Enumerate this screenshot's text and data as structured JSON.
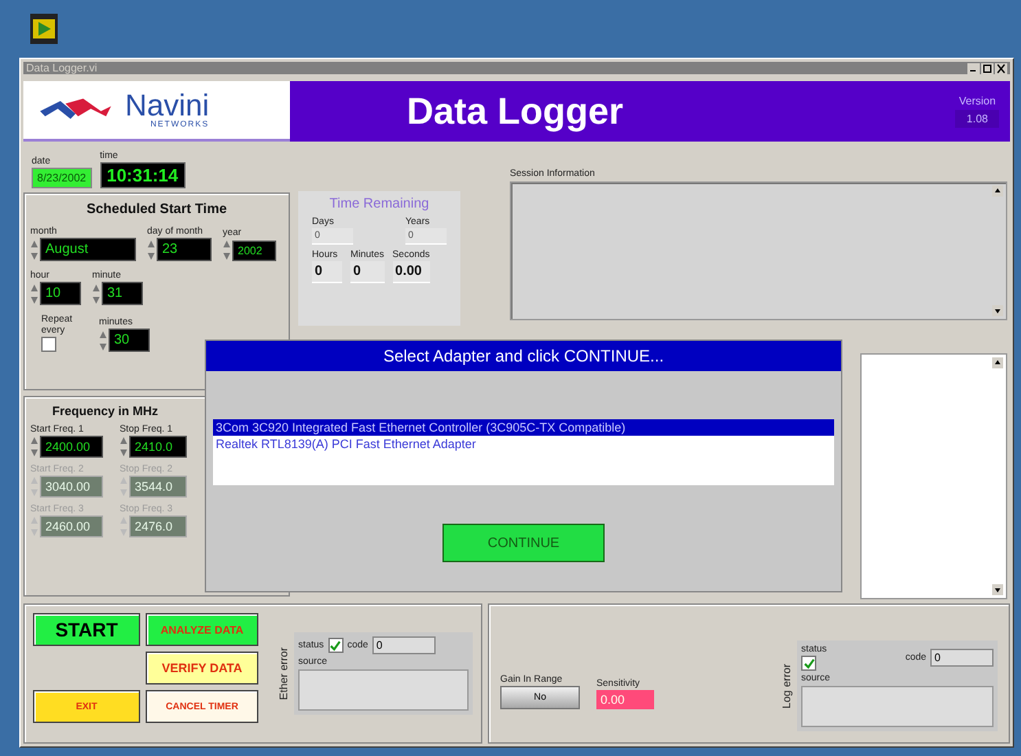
{
  "window": {
    "title": "Data Logger.vi"
  },
  "header": {
    "logo_text": "Navini",
    "logo_subtext": "NETWORKS",
    "title": "Data Logger",
    "version_label": "Version",
    "version": "1.08"
  },
  "date": {
    "label": "date",
    "value": "8/23/2002"
  },
  "time": {
    "label": "time",
    "value": "10:31:14"
  },
  "schedule": {
    "title": "Scheduled Start Time",
    "row1": [
      {
        "label": "month",
        "value": "August"
      },
      {
        "label": "day of month",
        "value": "23"
      },
      {
        "label": "year",
        "value": "2002"
      }
    ],
    "row2": [
      {
        "label": "hour",
        "value": "10"
      },
      {
        "label": "minute",
        "value": "31"
      }
    ],
    "repeat": {
      "label": "Repeat every",
      "checked": false
    },
    "interval": {
      "label": "minutes",
      "value": "30"
    }
  },
  "frequency": {
    "title": "Frequency in MHz",
    "rows": [
      [
        {
          "label": "Start Freq. 1",
          "value": "2400.00",
          "disabled": false
        },
        {
          "label": "Stop Freq. 1",
          "value": "2410.0",
          "disabled": false
        }
      ],
      [
        {
          "label": "Start Freq. 2",
          "value": "3040.00",
          "disabled": true
        },
        {
          "label": "Stop Freq. 2",
          "value": "3544.0",
          "disabled": true
        }
      ],
      [
        {
          "label": "Start Freq. 3",
          "value": "2460.00",
          "disabled": true
        },
        {
          "label": "Stop Freq. 3",
          "value": "2476.0",
          "disabled": true
        }
      ]
    ]
  },
  "time_remaining": {
    "title": "Time Remaining",
    "row1": [
      {
        "label": "Days",
        "value": "0"
      },
      {
        "label": "Years",
        "value": "0"
      }
    ],
    "row2": [
      {
        "label": "Hours",
        "value": "0"
      },
      {
        "label": "Minutes",
        "value": "0"
      },
      {
        "label": "Seconds",
        "value": "0.00"
      }
    ]
  },
  "session": {
    "label": "Session Information"
  },
  "buttons": [
    {
      "label": "START",
      "kind": "start"
    },
    {
      "label": "ANALYZE DATA",
      "kind": "analyze"
    },
    {
      "label": "VERIFY DATA",
      "kind": "verify"
    },
    {
      "label": "EXIT",
      "kind": "exit"
    },
    {
      "label": "CANCEL TIMER",
      "kind": "cancel"
    }
  ],
  "ether_error": {
    "label": "Ether error",
    "status_label": "status",
    "status": true,
    "code_label": "code",
    "code": "0",
    "source_label": "source"
  },
  "gain": {
    "label": "Gain In Range",
    "value": "No"
  },
  "sensitivity": {
    "label": "Sensitivity",
    "value": "0.00"
  },
  "log_error": {
    "label": "Log error",
    "status_label": "status",
    "status": true,
    "code_label": "code",
    "code": "0",
    "source_label": "source"
  },
  "dialog": {
    "title": "Select Adapter and click CONTINUE...",
    "adapters": [
      {
        "name": "3Com 3C920 Integrated Fast Ethernet Controller (3C905C-TX Compatible)",
        "selected": true
      },
      {
        "name": "Realtek RTL8139(A) PCI Fast Ethernet Adapter",
        "selected": false
      }
    ],
    "button": "CONTINUE"
  }
}
